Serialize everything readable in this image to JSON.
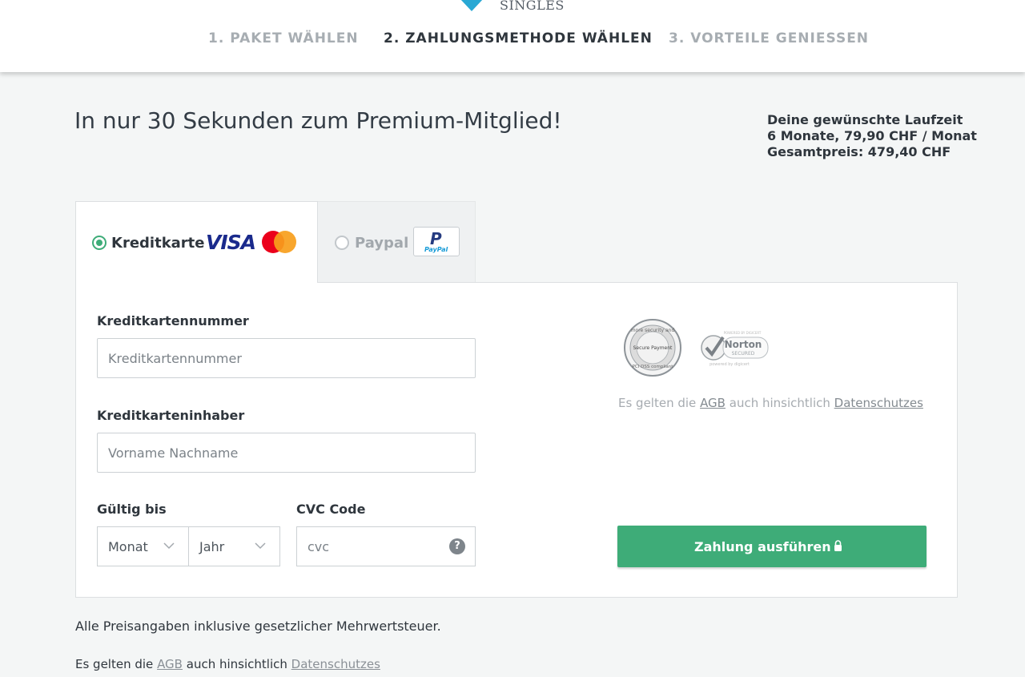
{
  "header": {
    "logo_text": "SINGLES",
    "steps": [
      {
        "label": "1. PAKET WÄHLEN"
      },
      {
        "label": "2. ZAHLUNGSMETHODE WÄHLEN"
      },
      {
        "label": "3. VORTEILE GENIESSEN"
      }
    ]
  },
  "main": {
    "title": "In nur 30 Sekunden zum Premium-Mitglied!"
  },
  "summary": {
    "heading": "Deine gewünschte Laufzeit",
    "duration_line": "6 Monate, 79,90 CHF / Monat",
    "total_line": "Gesamtpreis: 479,40 CHF"
  },
  "payment_tabs": {
    "card": {
      "label": "Kreditkarte",
      "visa": "VISA",
      "selected": true
    },
    "paypal": {
      "label": "Paypal",
      "logo_word": "PayPal",
      "selected": false
    }
  },
  "form": {
    "cc_number": {
      "label": "Kreditkartennummer",
      "placeholder": "Kreditkartennummer",
      "value": ""
    },
    "cc_holder": {
      "label": "Kreditkarteninhaber",
      "placeholder": "Vorname Nachname",
      "value": ""
    },
    "expiry": {
      "label": "Gültig bis",
      "month_selected": "Monat",
      "year_selected": "Jahr"
    },
    "cvc": {
      "label": "CVC Code",
      "placeholder": "cvc",
      "help": "?"
    },
    "submit_label": "Zahlung ausführen"
  },
  "seals": {
    "pci": {
      "line1": "more security and",
      "line2": "Secure Payment",
      "line3": "PCI DSS compliant"
    },
    "norton": {
      "top": "POWERED BY DIGICERT",
      "name": "Norton",
      "sub": "SECURED",
      "bottom": "powered by digicert"
    }
  },
  "terms": {
    "prefix": "Es gelten die",
    "agb": "AGB",
    "middle": "auch hinsichtlich",
    "privacy": "Datenschutzes"
  },
  "footer": {
    "vat_note": "Alle Preisangaben inklusive gesetzlicher Mehrwertsteuer."
  },
  "colors": {
    "accent_green": "#3eac78",
    "visa_blue": "#1a2a8c",
    "logo_teal": "#29a8d4"
  },
  "icons": [
    "logo-diamond-icon",
    "radio-selected-icon",
    "radio-unselected-icon",
    "visa-logo-icon",
    "mastercard-logo-icon",
    "paypal-logo-icon",
    "chevron-down-icon",
    "help-icon",
    "pci-seal-icon",
    "norton-seal-icon",
    "lock-icon"
  ]
}
